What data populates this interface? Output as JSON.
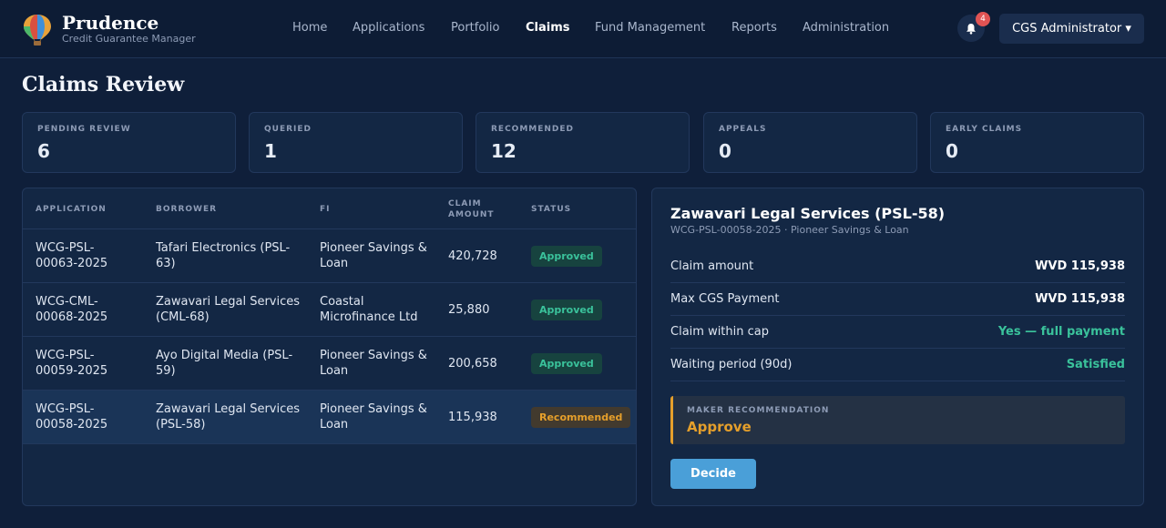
{
  "brand": {
    "name": "Prudence",
    "subtitle": "Credit Guarantee Manager"
  },
  "nav": {
    "items": [
      "Home",
      "Applications",
      "Portfolio",
      "Claims",
      "Fund Management",
      "Reports",
      "Administration"
    ],
    "active": "Claims"
  },
  "notifications": {
    "count": "4",
    "icon": "bell-icon"
  },
  "user": {
    "label": "CGS Administrator ▾"
  },
  "page": {
    "title": "Claims Review"
  },
  "stats": [
    {
      "label": "PENDING REVIEW",
      "value": "6"
    },
    {
      "label": "QUERIED",
      "value": "1"
    },
    {
      "label": "RECOMMENDED",
      "value": "12"
    },
    {
      "label": "APPEALS",
      "value": "0"
    },
    {
      "label": "EARLY CLAIMS",
      "value": "0"
    }
  ],
  "table": {
    "columns": [
      "APPLICATION",
      "BORROWER",
      "FI",
      "CLAIM AMOUNT",
      "STATUS"
    ],
    "rows": [
      {
        "application": "WCG-PSL-00063-2025",
        "borrower": "Tafari Electronics (PSL-63)",
        "fi": "Pioneer Savings & Loan",
        "amount": "420,728",
        "status": "Approved"
      },
      {
        "application": "WCG-CML-00068-2025",
        "borrower": "Zawavari Legal Services (CML-68)",
        "fi": "Coastal Microfinance Ltd",
        "amount": "25,880",
        "status": "Approved"
      },
      {
        "application": "WCG-PSL-00059-2025",
        "borrower": "Ayo Digital Media (PSL-59)",
        "fi": "Pioneer Savings & Loan",
        "amount": "200,658",
        "status": "Approved"
      },
      {
        "application": "WCG-PSL-00058-2025",
        "borrower": "Zawavari Legal Services (PSL-58)",
        "fi": "Pioneer Savings & Loan",
        "amount": "115,938",
        "status": "Recommended"
      }
    ]
  },
  "detail": {
    "title": "Zawavari Legal Services (PSL-58)",
    "subtitle": "WCG-PSL-00058-2025 · Pioneer Savings & Loan",
    "rows": [
      {
        "label": "Claim amount",
        "value": "WVD 115,938"
      },
      {
        "label": "Max CGS Payment",
        "value": "WVD 115,938"
      },
      {
        "label": "Claim within cap",
        "value": "Yes — full payment"
      },
      {
        "label": "Waiting period (90d)",
        "value": "Satisfied"
      }
    ],
    "recommendation": {
      "label": "MAKER RECOMMENDATION",
      "value": "Approve"
    },
    "decide_label": "Decide"
  },
  "colors": {
    "accent": "#4a9fd8",
    "approved": "#3ac29b",
    "recommended": "#e59f2b",
    "alert": "#e05353"
  }
}
